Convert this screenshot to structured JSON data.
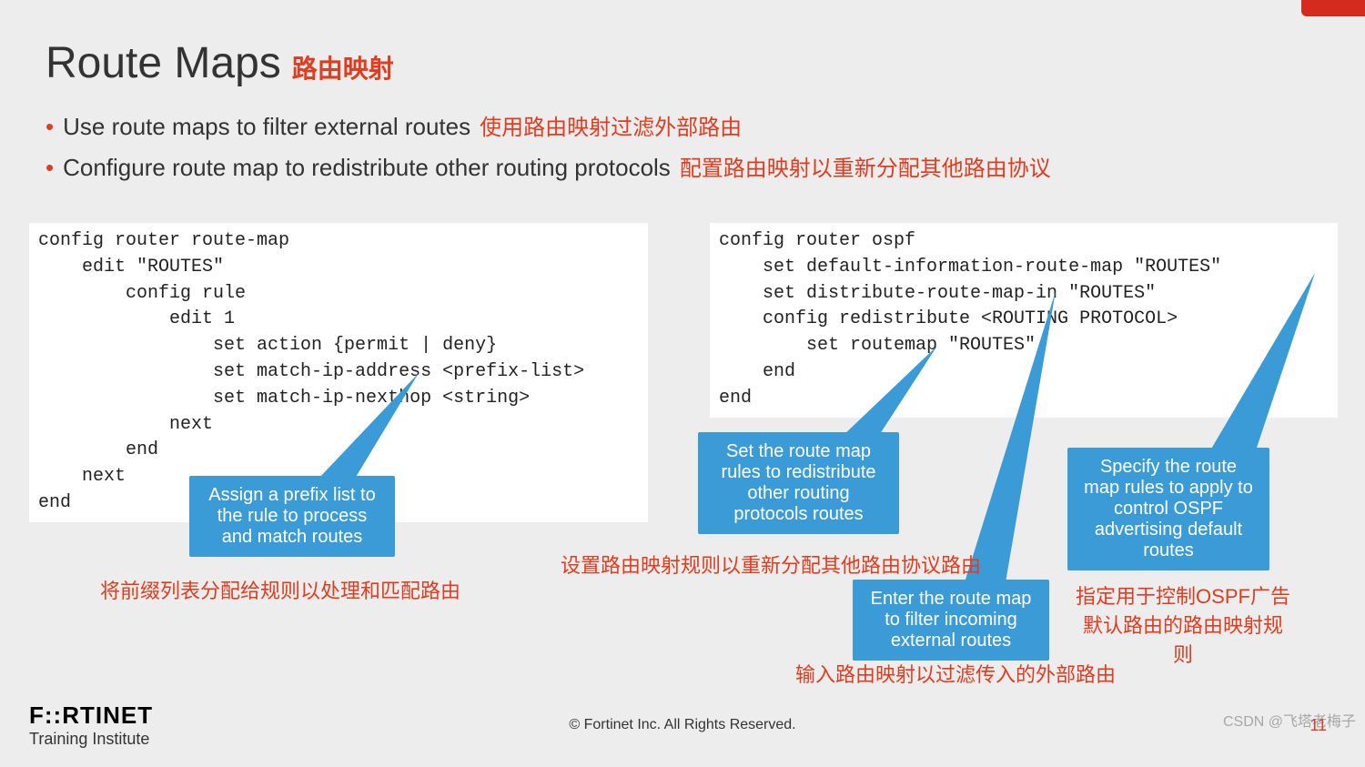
{
  "title": {
    "en": "Route Maps",
    "zh": "路由映射"
  },
  "bullets": [
    {
      "en": "Use route maps to filter external routes",
      "zh": "使用路由映射过滤外部路由"
    },
    {
      "en": "Configure route map to redistribute other routing protocols",
      "zh": "配置路由映射以重新分配其他路由协议"
    }
  ],
  "code_left": "config router route-map\n    edit \"ROUTES\"\n        config rule\n            edit 1\n                set action {permit | deny}\n                set match-ip-address <prefix-list>\n                set match-ip-nexthop <string>\n            next\n        end\n    next\nend",
  "code_right": "config router ospf\n    set default-information-route-map \"ROUTES\"\n    set distribute-route-map-in \"ROUTES\"\n    config redistribute <ROUTING PROTOCOL>\n        set routemap \"ROUTES\"\n    end\nend",
  "callouts": {
    "c1": "Assign a prefix list to the rule to process and match routes",
    "c2": "Set the route map rules to redistribute other routing protocols routes",
    "c3": "Enter the route map to filter incoming external routes",
    "c4": "Specify the route map rules to apply to control OSPF advertising default routes"
  },
  "red_labels": {
    "r1": "将前缀列表分配给规则以处理和匹配路由",
    "r2": "设置路由映射规则以重新分配其他路由协议路由",
    "r3": "输入路由映射以过滤传入的外部路由",
    "r4": "指定用于控制OSPF广告默认路由的路由映射规则"
  },
  "footer": {
    "logo_main": "F::RTINET",
    "logo_sub": "Training Institute",
    "copyright": "© Fortinet Inc. All Rights Reserved.",
    "page": "11",
    "watermark": "CSDN @飞塔老梅子"
  }
}
